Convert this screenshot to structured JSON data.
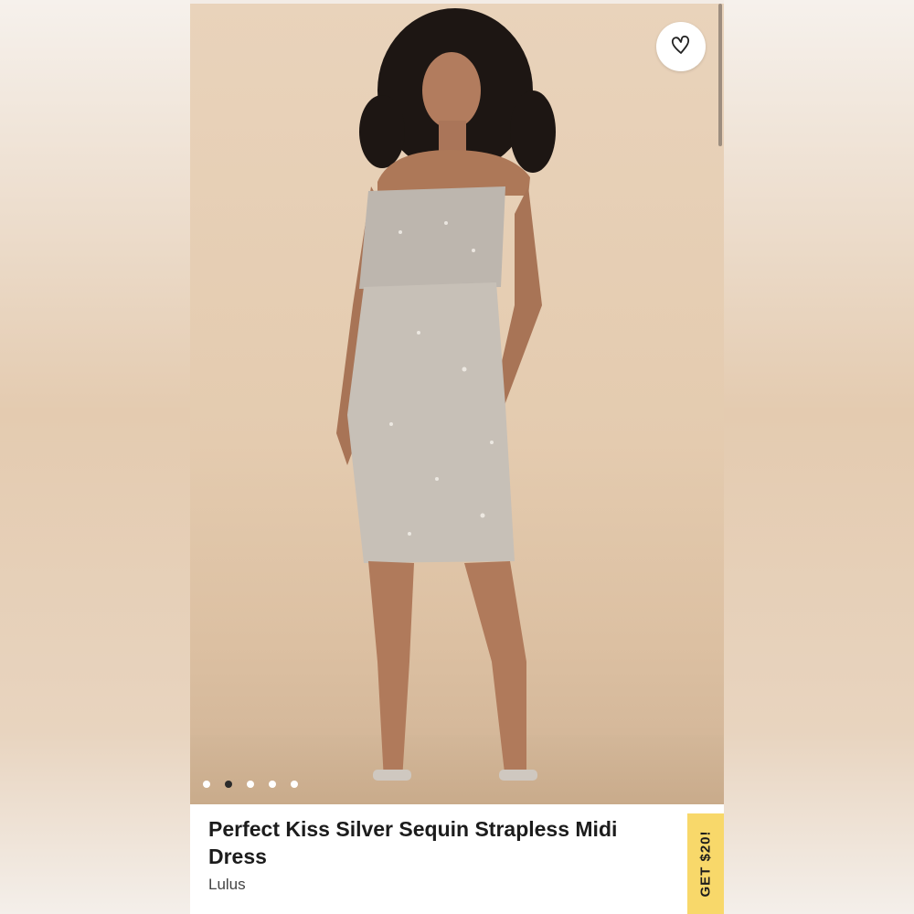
{
  "product": {
    "title": "Perfect Kiss Silver Sequin Strapless Midi Dress",
    "brand": "Lulus"
  },
  "gallery": {
    "dot_count": 5,
    "active_index": 1
  },
  "promo": {
    "label": "GET $20!"
  },
  "icons": {
    "favorite": "heart-outline-icon"
  },
  "colors": {
    "promo_bg": "#f8d86a",
    "photo_bg": "#e4cbaf",
    "text": "#1c1c1c"
  }
}
